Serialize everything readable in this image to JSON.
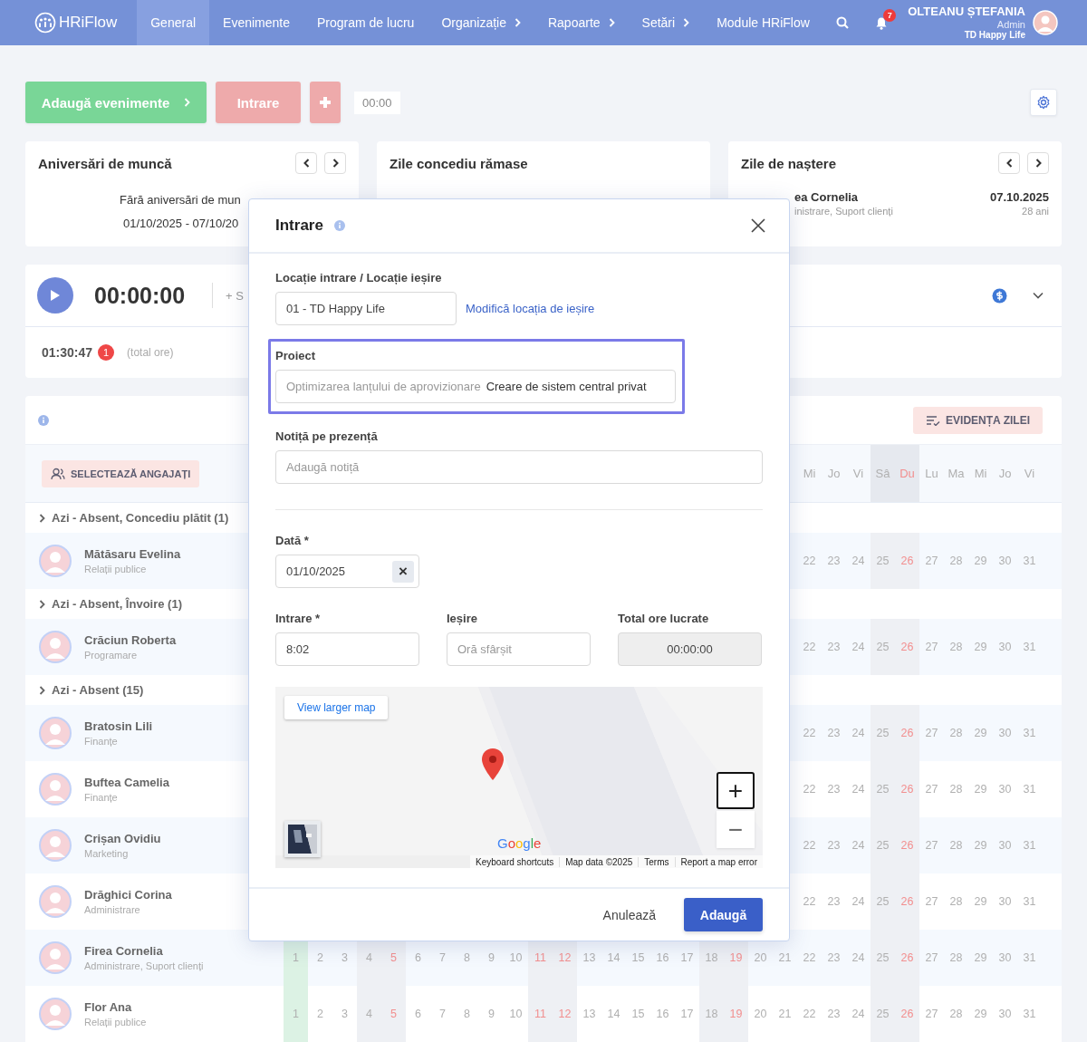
{
  "nav": {
    "brand": "HRiFlow",
    "items": [
      {
        "label": "General",
        "selected": true,
        "submenu": false
      },
      {
        "label": "Evenimente",
        "selected": false,
        "submenu": false
      },
      {
        "label": "Program de lucru",
        "selected": false,
        "submenu": false
      },
      {
        "label": "Organizație",
        "selected": false,
        "submenu": true
      },
      {
        "label": "Rapoarte",
        "selected": false,
        "submenu": true
      },
      {
        "label": "Setări",
        "selected": false,
        "submenu": true
      },
      {
        "label": "Module HRiFlow",
        "selected": false,
        "submenu": false
      }
    ],
    "notifications": "7",
    "user": {
      "name": "OLTEANU ȘTEFANIA",
      "role": "Admin",
      "company": "TD Happy Life"
    }
  },
  "toolbar": {
    "add_events": "Adaugă evenimente",
    "check_in": "Intrare",
    "time": "00:00"
  },
  "work_anniversaries": {
    "title": "Aniversări de muncă",
    "message": "Fără aniversări de mun",
    "range": "01/10/2025 - 07/10/20"
  },
  "leave_days": {
    "title": "Zile concediu rămase"
  },
  "birthdays": {
    "title": "Zile de naștere",
    "person": {
      "name": "ea Cornelia",
      "department": "inistrare, Suport clienți",
      "date": "07.10.2025",
      "age": "28 ani"
    }
  },
  "timer": {
    "elapsed": "00:00:00",
    "action": "+ S",
    "total": "01:30:47",
    "badge": "1",
    "total_label": "(total ore)"
  },
  "timesheet": {
    "day_record": "EVIDENȚA ZILEI",
    "select_employees": "SELECTEAZĂ ANGAJAȚI",
    "columns": [
      {
        "weekend": false,
        "red": false,
        "today": true
      },
      {
        "weekend": false,
        "red": false,
        "today": false
      },
      {
        "weekend": false,
        "red": false,
        "today": false
      },
      {
        "weekend": true,
        "red": false,
        "today": false
      },
      {
        "weekend": true,
        "red": true,
        "today": false
      },
      {
        "weekend": false,
        "red": false,
        "today": false
      },
      {
        "weekend": false,
        "red": false,
        "today": false
      },
      {
        "weekend": false,
        "red": false,
        "today": false
      },
      {
        "weekend": false,
        "red": false,
        "today": false
      },
      {
        "weekend": false,
        "red": false,
        "today": false
      },
      {
        "weekend": true,
        "red": true,
        "today": false
      },
      {
        "weekend": true,
        "red": true,
        "today": false
      },
      {
        "weekend": false,
        "red": false,
        "today": false
      },
      {
        "weekend": false,
        "red": false,
        "today": false
      },
      {
        "weekend": false,
        "red": false,
        "today": false
      },
      {
        "weekend": false,
        "red": false,
        "today": false
      },
      {
        "weekend": false,
        "red": false,
        "today": false
      },
      {
        "weekend": true,
        "red": false,
        "today": false
      },
      {
        "weekend": true,
        "red": true,
        "today": false
      },
      {
        "weekend": false,
        "red": false,
        "today": false
      },
      {
        "weekend": false,
        "red": false,
        "today": false
      },
      {
        "header": "Mi",
        "weekend": false,
        "red": false,
        "today": false
      },
      {
        "header": "Jo",
        "weekend": false,
        "red": false,
        "today": false
      },
      {
        "header": "Vi",
        "weekend": false,
        "red": false,
        "today": false
      },
      {
        "header": "Sâ",
        "weekend": true,
        "red": false,
        "today": false
      },
      {
        "header": "Du",
        "weekend": true,
        "red": true,
        "today": false
      },
      {
        "header": "Lu",
        "weekend": false,
        "red": false,
        "today": false
      },
      {
        "header": "Ma",
        "weekend": false,
        "red": false,
        "today": false
      },
      {
        "header": "Mi",
        "weekend": false,
        "red": false,
        "today": false
      },
      {
        "header": "Jo",
        "weekend": false,
        "red": false,
        "today": false
      },
      {
        "header": "Vi",
        "weekend": false,
        "red": false,
        "today": false
      }
    ],
    "rows": [
      {
        "kind": "group",
        "label": "Azi - Absent, Concediu plătit (1)"
      },
      {
        "kind": "person",
        "name": "Mătăsaru Evelina",
        "department": "Relații publice",
        "days": [
          "22",
          "23",
          "24",
          "25",
          "26",
          "27",
          "28",
          "29",
          "30",
          "31"
        ]
      },
      {
        "kind": "group",
        "label": "Azi - Absent, Învoire (1)"
      },
      {
        "kind": "person",
        "name": "Crăciun Roberta",
        "department": "Programare",
        "days": [
          "22",
          "23",
          "24",
          "25",
          "26",
          "27",
          "28",
          "29",
          "30",
          "31"
        ]
      },
      {
        "kind": "group",
        "label": "Azi - Absent (15)"
      },
      {
        "kind": "person",
        "name": "Bratosin Lili",
        "department": "Finanțe",
        "days": [
          "22",
          "23",
          "24",
          "25",
          "26",
          "27",
          "28",
          "29",
          "30",
          "31"
        ]
      },
      {
        "kind": "person",
        "name": "Buftea Camelia",
        "department": "Finanțe",
        "days": [
          "22",
          "23",
          "24",
          "25",
          "26",
          "27",
          "28",
          "29",
          "30",
          "31"
        ]
      },
      {
        "kind": "person",
        "name": "Crișan Ovidiu",
        "department": "Marketing",
        "days": [
          "22",
          "23",
          "24",
          "25",
          "26",
          "27",
          "28",
          "29",
          "30",
          "31"
        ]
      },
      {
        "kind": "person",
        "name": "Drăghici Corina",
        "department": "Administrare",
        "days": [
          "22",
          "23",
          "24",
          "25",
          "26",
          "27",
          "28",
          "29",
          "30",
          "31"
        ]
      },
      {
        "kind": "person",
        "name": "Firea Cornelia",
        "department": "Administrare, Suport clienți",
        "days": [
          "1",
          "2",
          "3",
          "4",
          "5",
          "6",
          "7",
          "8",
          "9",
          "10",
          "11",
          "12",
          "13",
          "14",
          "15",
          "16",
          "17",
          "18",
          "19",
          "20",
          "21",
          "22",
          "23",
          "24",
          "25",
          "26",
          "27",
          "28",
          "29",
          "30",
          "31"
        ]
      },
      {
        "kind": "person",
        "name": "Flor Ana",
        "department": "Relații publice",
        "days": [
          "1",
          "2",
          "3",
          "4",
          "5",
          "6",
          "7",
          "8",
          "9",
          "10",
          "11",
          "12",
          "13",
          "14",
          "15",
          "16",
          "17",
          "18",
          "19",
          "20",
          "21",
          "22",
          "23",
          "24",
          "25",
          "26",
          "27",
          "28",
          "29",
          "30",
          "31"
        ]
      }
    ]
  },
  "check_in_dialog": {
    "title": "Intrare",
    "location": {
      "label": "Locație intrare / Locație ieșire",
      "value": "01 - TD Happy Life",
      "change_link": "Modifică locația de ieșire"
    },
    "project": {
      "label": "Proiect",
      "group": "Optimizarea lanțului de aprovizionare",
      "value": "Creare de sistem central privat",
      "focused": true
    },
    "note": {
      "label": "Notiță pe prezență",
      "placeholder": "Adaugă notiță"
    },
    "date": {
      "label": "Dată *",
      "value": "01/10/2025",
      "clear": "×"
    },
    "check_in": {
      "label": "Intrare *",
      "value": "8:02"
    },
    "check_out": {
      "label": "Ieșire",
      "placeholder": "Oră sfârșit"
    },
    "total": {
      "label": "Total ore lucrate",
      "value": "00:00:00",
      "disabled": true
    },
    "map": {
      "larger_map": "View larger map",
      "zoom_in": "+",
      "zoom_out": "−",
      "logo": "Google",
      "attributions": [
        "Keyboard shortcuts",
        "Map data ©2025",
        "Terms",
        "Report a map error"
      ]
    },
    "cancel": "Anulează",
    "submit": "Adaugă"
  }
}
